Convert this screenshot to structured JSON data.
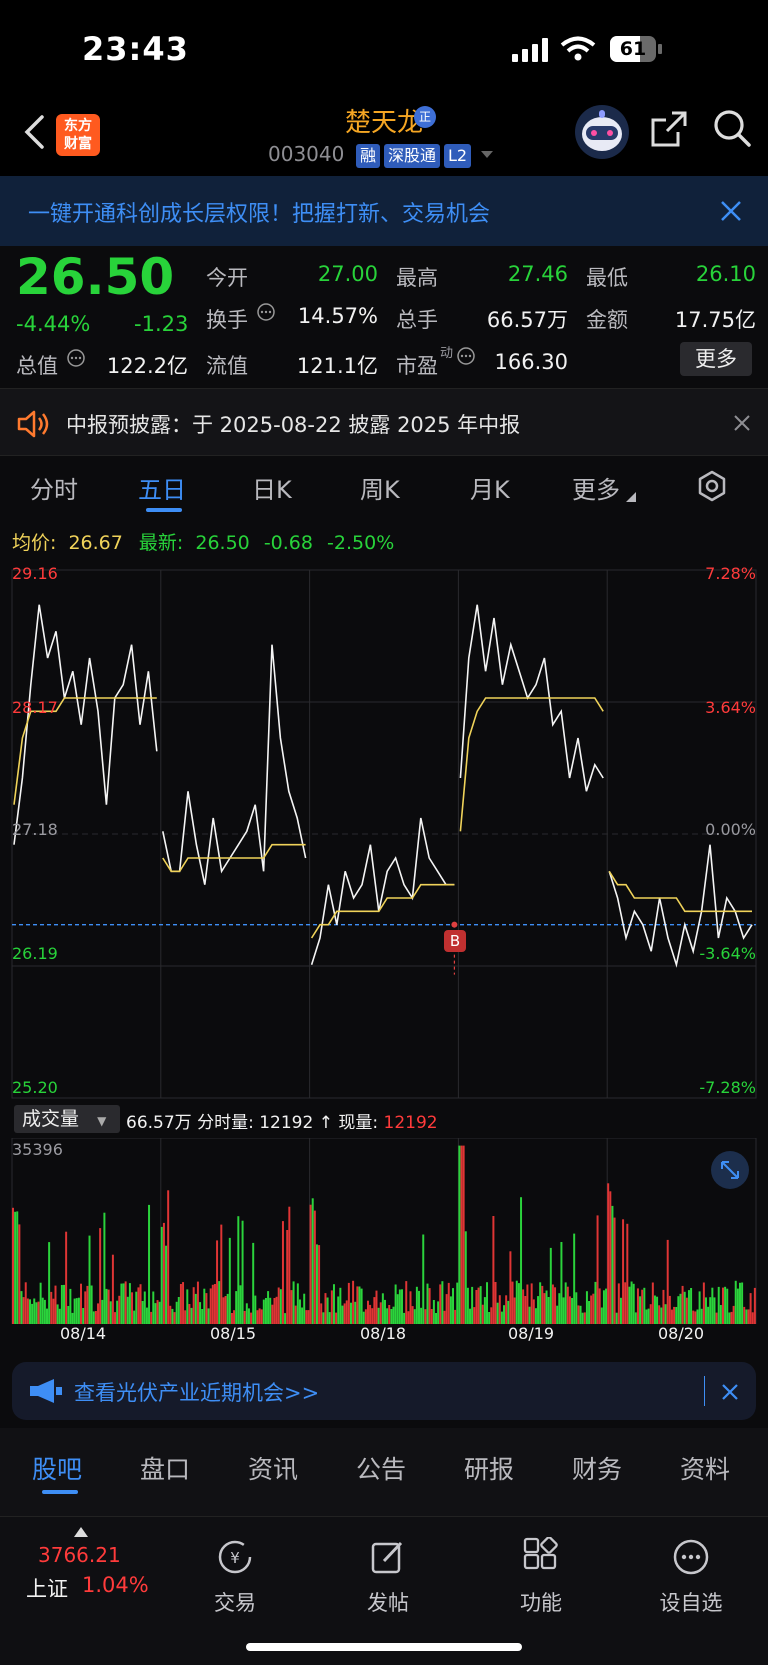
{
  "status_bar": {
    "time": "23:43",
    "battery": "61"
  },
  "header": {
    "back_icon": "chevron-left-icon",
    "logo_text": "东方财富",
    "stock_name": "楚天龙",
    "stock_code": "003040",
    "tags": [
      "融",
      "深股通",
      "L2"
    ],
    "badge": "正"
  },
  "banner": {
    "text": "一键开通科创成长层权限！把握打新、交易机会"
  },
  "quote": {
    "price": "26.50",
    "change_pct": "-4.44%",
    "change": "-1.23",
    "open_label": "今开",
    "open": "27.00",
    "high_label": "最高",
    "high": "27.46",
    "low_label": "最低",
    "low": "26.10",
    "turnover_label": "换手",
    "turnover": "14.57%",
    "volume_label": "总手",
    "volume": "66.57万",
    "amount_label": "金额",
    "amount": "17.75亿",
    "mktcap_label": "总值",
    "mktcap": "122.2亿",
    "float_label": "流值",
    "float": "121.1亿",
    "pe_label": "市盈",
    "pe_sup": "动",
    "pe": "166.30",
    "more_label": "更多"
  },
  "notice": {
    "text": "中报预披露：于 2025-08-22 披露 2025 年中报"
  },
  "tabs": [
    "分时",
    "五日",
    "日K",
    "周K",
    "月K",
    "更多"
  ],
  "chart_info": {
    "avg_label": "均价:",
    "avg": "26.67",
    "latest_label": "最新:",
    "latest": "26.50",
    "chg": "-0.68",
    "chg_pct": "-2.50%"
  },
  "chart_data": {
    "type": "line",
    "y_left_ticks": [
      "29.16",
      "28.17",
      "27.18",
      "26.19",
      "25.20"
    ],
    "y_right_ticks": [
      "7.28%",
      "3.64%",
      "0.00%",
      "-3.64%",
      "-7.28%"
    ],
    "ylim": [
      25.2,
      29.16
    ],
    "prev_close": 27.18,
    "days": [
      "08/14",
      "08/15",
      "08/18",
      "08/19",
      "08/20"
    ],
    "series": [
      {
        "values": [
          [
            27.1,
            27.6,
            28.3,
            28.9,
            28.5,
            28.7,
            28.2,
            28.4,
            28.0,
            28.5,
            28.1,
            27.4,
            28.2,
            28.3,
            28.6,
            28.0,
            28.4,
            27.8
          ],
          [
            27.2,
            26.9,
            26.9,
            27.5,
            27.1,
            26.8,
            27.3,
            26.9,
            27.0,
            27.1,
            27.2,
            27.4,
            26.9,
            28.6,
            27.9,
            27.5,
            27.3,
            27.0
          ],
          [
            26.2,
            26.4,
            26.8,
            26.5,
            26.9,
            26.7,
            26.8,
            27.1,
            26.6,
            26.9,
            27.0,
            26.8,
            26.7,
            27.3,
            27.0,
            26.9,
            26.8,
            26.8
          ],
          [
            27.6,
            28.5,
            28.9,
            28.4,
            28.8,
            28.3,
            28.6,
            28.4,
            28.2,
            28.3,
            28.5,
            28.0,
            28.1,
            27.6,
            27.9,
            27.5,
            27.7,
            27.6
          ],
          [
            26.9,
            26.7,
            26.4,
            26.6,
            26.5,
            26.3,
            26.7,
            26.4,
            26.2,
            26.5,
            26.3,
            26.6,
            27.1,
            26.4,
            26.7,
            26.6,
            26.4,
            26.5
          ]
        ]
      },
      {
        "values": [
          [
            27.4,
            27.9,
            28.1,
            28.1,
            28.1,
            28.1,
            28.2,
            28.2,
            28.2,
            28.2,
            28.2,
            28.2,
            28.2,
            28.2,
            28.2,
            28.2,
            28.2,
            28.2
          ],
          [
            27.0,
            26.9,
            26.9,
            27.0,
            27.0,
            27.0,
            27.0,
            27.0,
            27.0,
            27.0,
            27.0,
            27.0,
            27.0,
            27.1,
            27.1,
            27.1,
            27.1,
            27.1
          ],
          [
            26.4,
            26.5,
            26.5,
            26.6,
            26.6,
            26.6,
            26.6,
            26.6,
            26.6,
            26.7,
            26.7,
            26.7,
            26.7,
            26.8,
            26.8,
            26.8,
            26.8,
            26.8
          ],
          [
            27.2,
            27.9,
            28.1,
            28.2,
            28.2,
            28.2,
            28.2,
            28.2,
            28.2,
            28.2,
            28.2,
            28.2,
            28.2,
            28.2,
            28.2,
            28.2,
            28.2,
            28.1
          ],
          [
            26.9,
            26.8,
            26.8,
            26.7,
            26.7,
            26.7,
            26.7,
            26.7,
            26.7,
            26.6,
            26.6,
            26.6,
            26.6,
            26.6,
            26.6,
            26.6,
            26.6,
            26.6
          ]
        ]
      }
    ],
    "marker_label": "B"
  },
  "volume": {
    "selector_label": "成交量",
    "total": "66.57万",
    "fen_label": "分时量:",
    "fen_value": "12192",
    "arrow": "↑",
    "now_label": "现量:",
    "now_value": "12192",
    "max_label": "35396",
    "bars_max": 35396
  },
  "promo": {
    "text": "查看光伏产业近期机会>>"
  },
  "sub_tabs": [
    "股吧",
    "盘口",
    "资讯",
    "公告",
    "研报",
    "财务",
    "资料"
  ],
  "bottom_bar": {
    "index_value": "3766.21",
    "index_name": "上证",
    "index_pct": "1.04%",
    "items": [
      "交易",
      "发帖",
      "功能",
      "设自选"
    ]
  },
  "colors": {
    "up": "#ff3b3b",
    "down": "#28d33a",
    "accent": "#3e8ef5",
    "avg_line": "#f0d35a"
  }
}
